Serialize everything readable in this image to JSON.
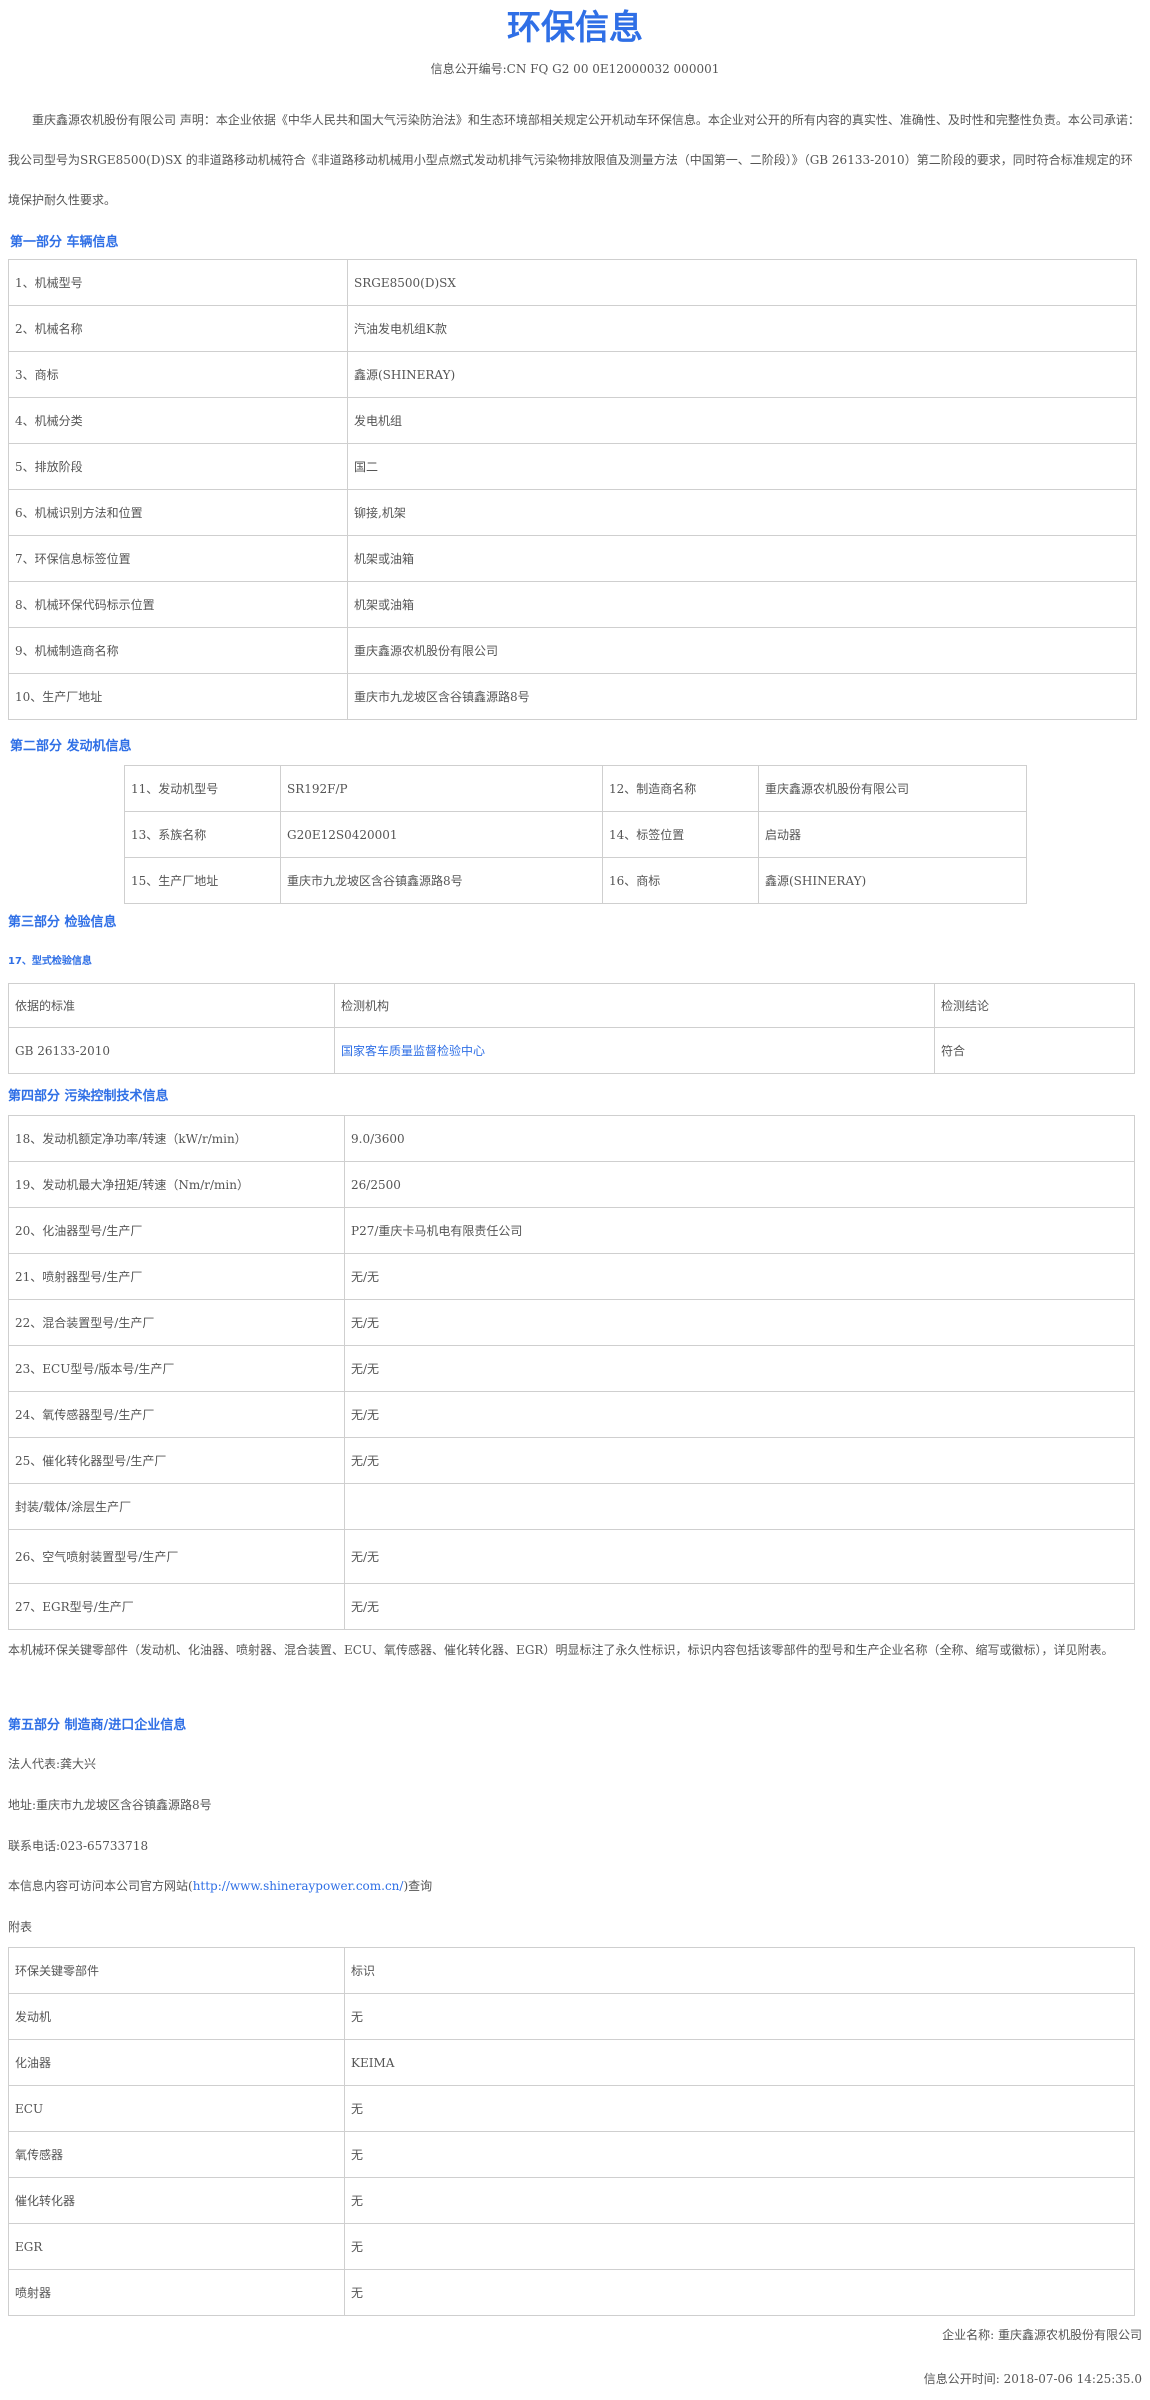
{
  "header": {
    "title": "环保信息",
    "doc_no": "信息公开编号:CN FQ G2 00 0E12000032 000001"
  },
  "intro": "重庆鑫源农机股份有限公司 声明：本企业依据《中华人民共和国大气污染防治法》和生态环境部相关规定公开机动车环保信息。本企业对公开的所有内容的真实性、准确性、及时性和完整性负责。本公司承诺：我公司型号为SRGE8500(D)SX 的非道路移动机械符合《非道路移动机械用小型点燃式发动机排气污染物排放限值及测量方法（中国第一、二阶段）》（GB 26133-2010）第二阶段的要求，同时符合标准规定的环境保护耐久性要求。",
  "part1": {
    "heading": "第一部分 车辆信息",
    "rows": [
      {
        "label": "1、机械型号",
        "value": "SRGE8500(D)SX"
      },
      {
        "label": "2、机械名称",
        "value": "汽油发电机组K款"
      },
      {
        "label": "3、商标",
        "value": "鑫源(SHINERAY)"
      },
      {
        "label": "4、机械分类",
        "value": "发电机组"
      },
      {
        "label": "5、排放阶段",
        "value": "国二"
      },
      {
        "label": "6、机械识别方法和位置",
        "value": "铆接,机架"
      },
      {
        "label": "7、环保信息标签位置",
        "value": "机架或油箱"
      },
      {
        "label": "8、机械环保代码标示位置",
        "value": "机架或油箱"
      },
      {
        "label": "9、机械制造商名称",
        "value": "重庆鑫源农机股份有限公司"
      },
      {
        "label": "10、生产厂地址",
        "value": "重庆市九龙坡区含谷镇鑫源路8号"
      }
    ]
  },
  "part2": {
    "heading": "第二部分 发动机信息",
    "rows": [
      [
        "11、发动机型号",
        "SR192F/P",
        "12、制造商名称",
        "重庆鑫源农机股份有限公司"
      ],
      [
        "13、系族名称",
        "G20E12S0420001",
        "14、标签位置",
        "启动器"
      ],
      [
        "15、生产厂地址",
        "重庆市九龙坡区含谷镇鑫源路8号",
        "16、商标",
        "鑫源(SHINERAY)"
      ]
    ]
  },
  "part3": {
    "heading": "第三部分  检验信息",
    "subheading": "17、型式检验信息",
    "headers": [
      "依据的标准",
      "检测机构",
      "检测结论"
    ],
    "row": [
      "GB 26133-2010",
      "国家客车质量监督检验中心",
      "符合"
    ]
  },
  "part4": {
    "heading": "第四部分 污染控制技术信息",
    "rows": [
      {
        "label": "18、发动机额定净功率/转速（kW/r/min）",
        "value": "9.0/3600"
      },
      {
        "label": "19、发动机最大净扭矩/转速（Nm/r/min）",
        "value": "26/2500"
      },
      {
        "label": "20、化油器型号/生产厂",
        "value": "P27/重庆卡马机电有限责任公司"
      },
      {
        "label": "21、喷射器型号/生产厂",
        "value": "无/无"
      },
      {
        "label": "22、混合装置型号/生产厂",
        "value": "无/无"
      },
      {
        "label": "23、ECU型号/版本号/生产厂",
        "value": "无/无"
      },
      {
        "label": "24、氧传感器型号/生产厂",
        "value": "无/无"
      },
      {
        "label": "25、催化转化器型号/生产厂",
        "value": "无/无"
      },
      {
        "label": "封装/载体/涂层生产厂",
        "value": ""
      },
      {
        "label": "26、空气喷射装置型号/生产厂",
        "value": "无/无"
      },
      {
        "label": "27、EGR型号/生产厂",
        "value": "无/无"
      }
    ],
    "note": "本机械环保关键零部件（发动机、化油器、喷射器、混合装置、ECU、氧传感器、催化转化器、EGR）明显标注了永久性标识，标识内容包括该零部件的型号和生产企业名称（全称、缩写或徽标），详见附表。"
  },
  "part5": {
    "heading": "第五部分 制造商/进口企业信息",
    "legal_rep": "法人代表:龚大兴",
    "address": "地址:重庆市九龙坡区含谷镇鑫源路8号",
    "phone": "联系电话:023-65733718",
    "visit_prefix": "本信息内容可访问本公司官方网站(",
    "visit_url": "http://www.shineraypower.com.cn/",
    "visit_suffix": ")查询"
  },
  "appendix": {
    "title": "附表",
    "headers": [
      "环保关键零部件",
      "标识"
    ],
    "rows": [
      [
        "发动机",
        "无"
      ],
      [
        "化油器",
        "KEIMA"
      ],
      [
        "ECU",
        "无"
      ],
      [
        "氧传感器",
        "无"
      ],
      [
        "催化转化器",
        "无"
      ],
      [
        "EGR",
        "无"
      ],
      [
        "喷射器",
        "无"
      ]
    ]
  },
  "footer": {
    "company": "企业名称: 重庆鑫源农机股份有限公司",
    "published": "信息公开时间: 2018-07-06 14:25:35.0"
  }
}
